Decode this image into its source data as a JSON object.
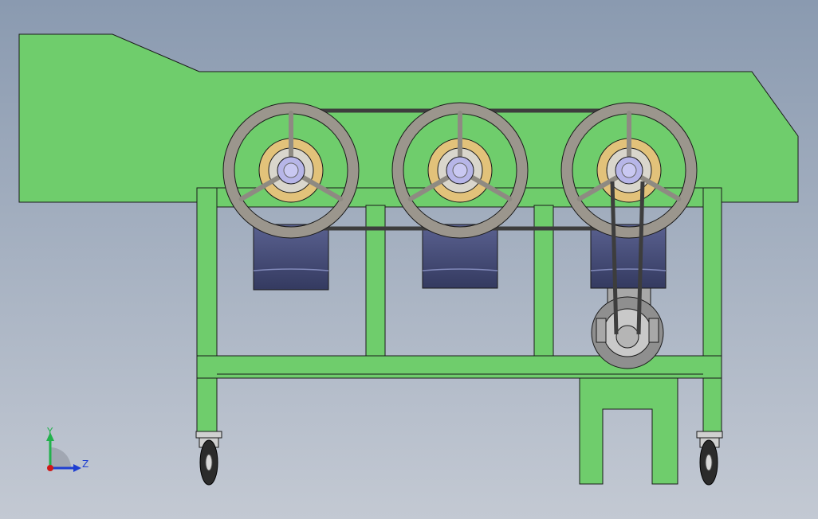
{
  "axis_triad": {
    "y_label": "Y",
    "z_label": "Z",
    "y_color": "#22b14c",
    "z_color": "#1f3fd1",
    "origin_color": "#d01818"
  },
  "colors": {
    "background_top": "#8a9ab0",
    "background_bottom": "#c3c9d3",
    "frame_green": "#6fcd6c",
    "outline": "#1a1a1a",
    "pulley_rim": "#9b968d",
    "pulley_spoke": "#8e8a82",
    "hub": "#b7b6e8",
    "bearing_housing": "#e2c27a",
    "belt": "#3d3d3d",
    "bin_dark": "#343a60",
    "bin_light": "#5a6190",
    "motor_gray": "#a8a8a8",
    "caster_tire": "#2b2b2b"
  },
  "drive": {
    "pulley_count": 3,
    "spokes_per_pulley": 3
  }
}
